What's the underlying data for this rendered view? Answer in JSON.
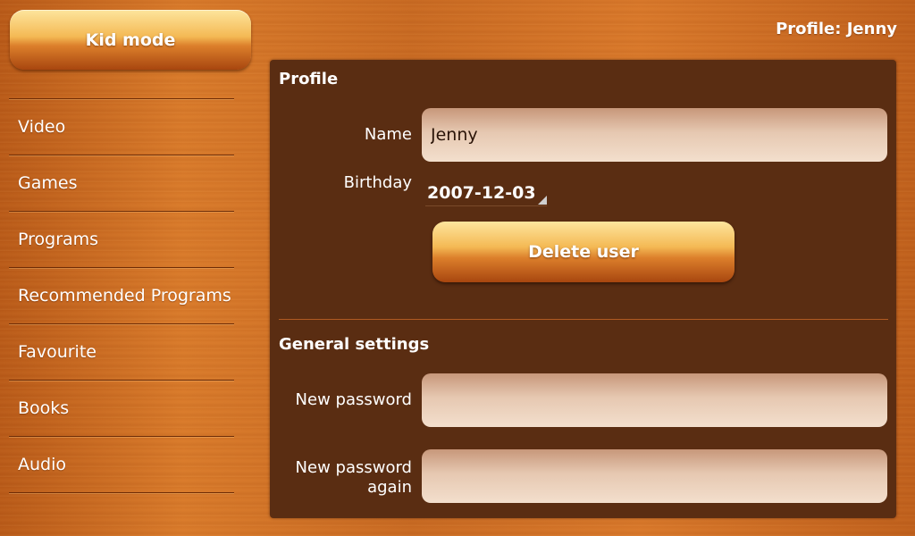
{
  "header": {
    "kid_mode_label": "Kid mode",
    "profile_label": "Profile: Jenny"
  },
  "sidebar": {
    "items": [
      {
        "label": "Video"
      },
      {
        "label": "Games"
      },
      {
        "label": "Programs"
      },
      {
        "label": "Recommended Programs"
      },
      {
        "label": "Favourite"
      },
      {
        "label": "Books"
      },
      {
        "label": "Audio"
      }
    ]
  },
  "profile": {
    "title": "Profile",
    "name_label": "Name",
    "name_value": "Jenny",
    "birthday_label": "Birthday",
    "birthday_value": "2007-12-03",
    "delete_label": "Delete user"
  },
  "general": {
    "title": "General settings",
    "new_password_label": "New password",
    "new_password_value": "",
    "new_password_again_label": "New password again",
    "new_password_again_value": ""
  },
  "colors": {
    "panel": "#5a2d12",
    "wood": "#c96a22",
    "button_top": "#fde59d",
    "button_bottom": "#a8460f"
  }
}
